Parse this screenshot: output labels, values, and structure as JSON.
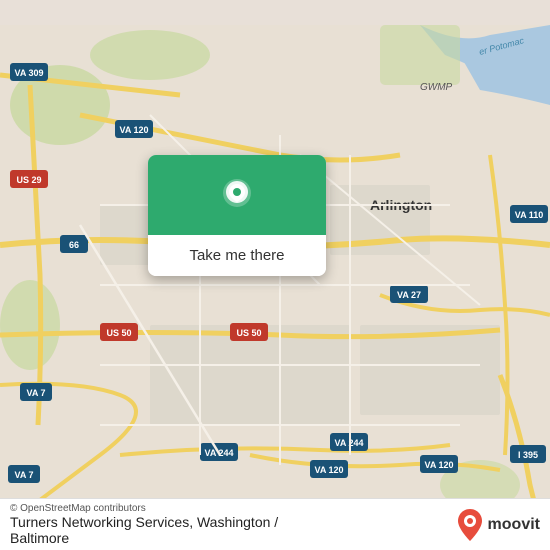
{
  "map": {
    "alt": "Map of Arlington, Washington area",
    "center_label": "Arlington"
  },
  "popup": {
    "button_label": "Take me there"
  },
  "bottom_bar": {
    "copyright": "© OpenStreetMap contributors",
    "location_name": "Turners Networking Services, Washington /",
    "location_name2": "Baltimore",
    "moovit_label": "moovit"
  }
}
